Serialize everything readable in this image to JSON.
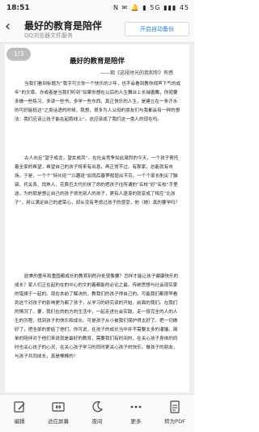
{
  "status_bar": {
    "time": "18:51",
    "icons_text": "N ✉ 🔔 ▮ 5G ▮▮▮ 45"
  },
  "header": {
    "title": "最好的教育是陪伴",
    "subtitle": "QQ浏览器文件服务",
    "backup_label": "开启自动备份",
    "back_glyph": "‹"
  },
  "page_indicator": "1/3",
  "document": {
    "title": "最好的教育是陪伴",
    "citation": "——观《这段时光的我和你》有感",
    "paragraphs": [
      "当我们看到标题为“我字可文你一个快乐的少年，也不会看到教你视声下气的成年”的文章。亦或者是当我们听到“如果你想在以后的人生舞台上长袖善舞，你就要多做一些练习，多读一些书，多学一些东西，真正快乐的人生，是建立在一条汗水的可好能抵达”之类话语的时候，我想，很多为人父母的朋友们与我都会有一样的想法：我们应该让孩子能在起跑线上”。这应该成了我们这一类人的现在吗。",
      "古人向且“望子成龙，望女成凤”。在社会竞争如此激烈的今天，一个孩子寄托着全家的希望，希望自己的孩子将来有出息，再正常不过。有那家，总能就有市场。于是，一个个“特长班”“兴趣班”如雨后春笋般层出不穷。一个个家长削尖了脑袋、托关系、找熟人、花费巨大代价拼了命的把孩子往所谓的“名校”好“名校”手里送。为的就是想让自己的孩子领先别人的孩子，更有人逐渐的就变成了相互“比孩子”，用以满足自己的虚荣心，却从没有考虑过孩子的感受，他（她）真的要学吗？",
      "欧美的童年和重国都成长的教育别的孙处就像要？怎样才能让孩子健康快乐的成长？家人们正在起的在的中心的文的着都能的必论之最。传统思想与社会现实家的错揉于一起的。现在本前了解决的，教我们的孩子得自己的。可能我们都很早看到这个对孩子的影响更为都了孩子，从学习的研究读的开始，前面的我们。在我们的情况了。要，我们在的的方的生活中，一起走进社会实践，走一段完全的人的人生的历程。找到孩子的快乐和成长。可是孩子从小被我们保护得太好了。把一切做好了，把全部的爱给了他们，你可说，在孩子的成长当中并不需要太多的灌输。简单的陪伴对于他们来说就是最好的教育，需要我们有时间的，在关心孩子身体的同时也关心孩子的心灵，在关心孩子学习的同时更关心孩子的快乐。做孩子的朋友，与孩子共同成长，真是棒棒的！"
    ]
  },
  "bottom_nav": [
    {
      "label": "编辑",
      "icon": "edit-icon"
    },
    {
      "label": "适应屏幕",
      "icon": "fit-screen-icon"
    },
    {
      "label": "夜间",
      "icon": "night-mode-icon"
    },
    {
      "label": "更多",
      "icon": "more-icon"
    },
    {
      "label": "转为PDF",
      "icon": "pdf-icon"
    }
  ]
}
